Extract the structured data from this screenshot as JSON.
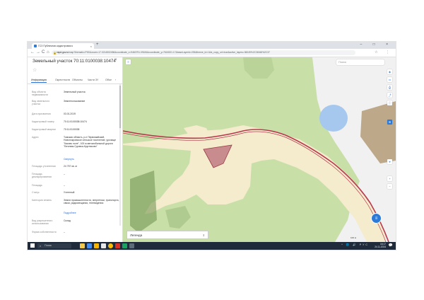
{
  "browser": {
    "tab_title": "ГСЗ Публичная кадастровая к",
    "tab_close": "×",
    "new_tab": "+",
    "window_controls": "– □ ×",
    "nav_back": "←",
    "nav_forward": "→",
    "nav_reload": "C",
    "nav_home": "⌂",
    "lock": "🔒",
    "url_host": "nspd.gov.ru",
    "url_rest": "/map?thematic=PKK&zoom=17.0214502456&coordinate_x=9460791.09184&coordinate_y=7618321.17&baseLayerId=235&theme_id=1&is_copy_url=true&active_layers=36049%2C36048%2C37",
    "toolbar_icons": "☆ ⋮"
  },
  "panel": {
    "title": "Земельный участок 70:11:0100038:10474",
    "close": "×",
    "star": "☆",
    "tabs": [
      "Информация",
      "Окрестности",
      "Объекты",
      "Части ЗУ",
      "Объе"
    ],
    "tabs_next": "›",
    "rows": [
      {
        "label": "Вид объекта недвижимости",
        "value": "Земельный участок"
      },
      {
        "label": "Вид земельного участка",
        "value": "Землепользование"
      },
      {
        "label": "Дата присвоения",
        "value": "03.01.2019"
      },
      {
        "label": "Кадастровый номер",
        "value": "70:11:0100038:10474"
      },
      {
        "label": "Кадастровый квартал",
        "value": "70:11:0100038"
      },
      {
        "label": "Адрес",
        "value": "Томская область, р-н Первомайский, Новопокровское сельское поселение, урочище \"Каково поле\", 100 м автомобильной дороги \"Бечевая-Гуровка-Кругликово\""
      },
      {
        "label": "Площадь уточненная",
        "value": "24 757 кв. м"
      },
      {
        "label": "Площадь декларированная",
        "value": "–"
      },
      {
        "label": "Площадь",
        "value": "–"
      },
      {
        "label": "Статус",
        "value": "Учтенный"
      },
      {
        "label": "Категория земель",
        "value": "Земли промышленности, энергетики, транспорта, связи, радиовещания, телевидения"
      },
      {
        "label": "Вид разрешенного использования",
        "value": "Склад"
      },
      {
        "label": "Форма собственности",
        "value": "–"
      }
    ],
    "link_collapse": "Свернуть",
    "link_more": "Подробнее"
  },
  "map": {
    "search_placeholder": "Поиск",
    "legend_label": "Легенда",
    "legend_chevron": "⇕",
    "scale_text": "100 м",
    "colors": {
      "forest": "#c9dfa8",
      "forest_dark": "#b0cb8f",
      "clearing": "#f4eccd",
      "parcel_fill": "#c88c8f",
      "parcel_stroke": "#9a3a44",
      "road": "#b8394e",
      "water": "#a6c7ee",
      "building": "#bda88a",
      "urban": "#f1f1f1",
      "dark_green": "#6b8f4a"
    }
  },
  "taskbar": {
    "search_label": "Поиск",
    "tray_text": "^ 🌐 🔊 РУС",
    "time": "16:17",
    "date": "24.11.2024",
    "notification": "💬"
  }
}
